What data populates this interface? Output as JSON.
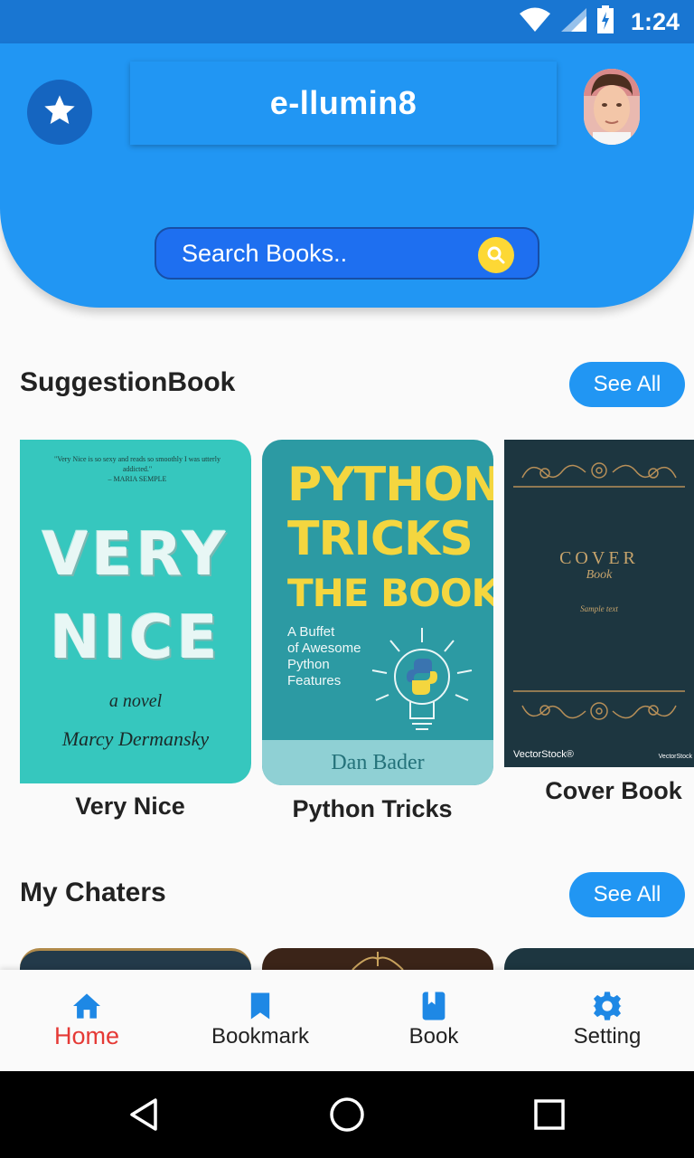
{
  "status_bar": {
    "time": "1:24",
    "icons": [
      "wifi-icon",
      "signal-icon",
      "battery-charging-icon"
    ]
  },
  "header": {
    "title": "e-llumin8",
    "favorite_icon": "star-icon",
    "avatar": "user-avatar",
    "search": {
      "placeholder": "Search Books..",
      "value": "",
      "icon": "search-icon"
    }
  },
  "colors": {
    "primary": "#2196f3",
    "primary_dark": "#1976d2",
    "search_bg": "#1e6ff0",
    "accent_yellow": "#fdd835",
    "active_nav": "#e53935"
  },
  "suggestion_section": {
    "title": "SuggestionBook",
    "see_all_label": "See All",
    "books": [
      {
        "label": "Very Nice",
        "cover": {
          "quote": "\"Very Nice is so sexy and reads so smoothly I was utterly addicted.\"",
          "quote_author": "– MARIA SEMPLE",
          "title_line1": "VERY",
          "title_line2": "NICE",
          "subtitle": "a novel",
          "author": "Marcy Dermansky"
        }
      },
      {
        "label": "Python Tricks",
        "cover": {
          "title_line1": "PYTHON",
          "title_line2": "TRICKS",
          "title_line3": "THE BOOK",
          "subtitle_line1": "A Buffet",
          "subtitle_line2": "of Awesome",
          "subtitle_line3": "Python",
          "subtitle_line4": "Features",
          "author": "Dan Bader"
        }
      },
      {
        "label": "Cover Book",
        "cover": {
          "title": "COVER",
          "subtitle": "Book",
          "sample": "Sample text",
          "watermark": "VectorStock®",
          "watermark_small": "VectorStock"
        }
      }
    ]
  },
  "chapters_section": {
    "title": "My Chaters",
    "see_all_label": "See All"
  },
  "bottom_nav": {
    "items": [
      {
        "label": "Home",
        "icon": "home-icon",
        "active": true
      },
      {
        "label": "Bookmark",
        "icon": "bookmark-icon",
        "active": false
      },
      {
        "label": "Book",
        "icon": "book-icon",
        "active": false
      },
      {
        "label": "Setting",
        "icon": "gear-icon",
        "active": false
      }
    ]
  },
  "system_nav": {
    "buttons": [
      "back-icon",
      "home-circle-icon",
      "recents-icon"
    ]
  }
}
